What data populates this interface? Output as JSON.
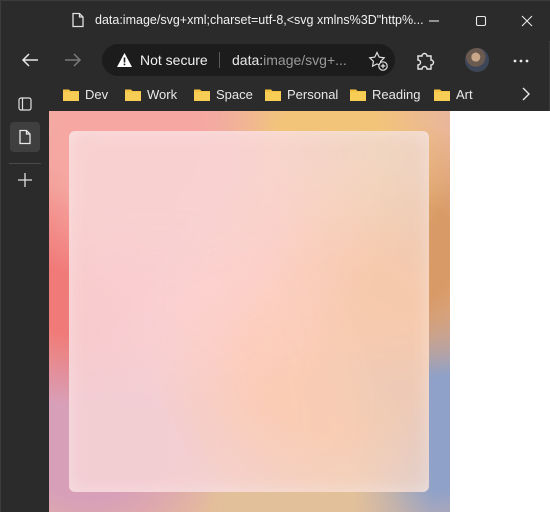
{
  "window": {
    "tab_title": "data:image/svg+xml;charset=utf-8,<svg xmlns%3D\"http%..."
  },
  "toolbar": {
    "security_label": "Not secure",
    "url_scheme": "data:",
    "url_rest": "image/svg+..."
  },
  "bookmarks": [
    {
      "label": "Dev"
    },
    {
      "label": "Work"
    },
    {
      "label": "Space"
    },
    {
      "label": "Personal"
    },
    {
      "label": "Reading"
    },
    {
      "label": "Art"
    }
  ],
  "colors": {
    "folder": "#f5c342",
    "warning": "#ffffff",
    "frame_bg": "#2b2b2b",
    "omnibox_bg": "#1c1c1c"
  },
  "icons": {
    "back": "arrow-left-icon",
    "forward": "arrow-right-icon",
    "warning": "warning-triangle-icon",
    "favorites": "star-add-icon",
    "extensions": "puzzle-icon",
    "more": "more-horizontal-icon"
  }
}
